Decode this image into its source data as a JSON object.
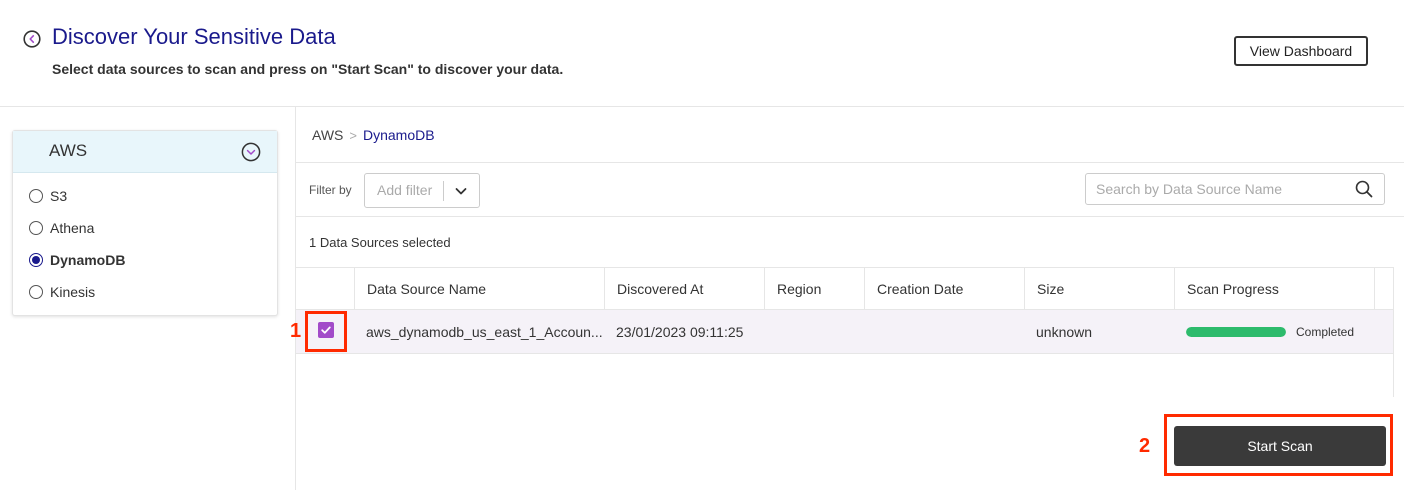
{
  "header": {
    "title": "Discover Your Sensitive Data",
    "subtitle": "Select data sources to scan and press on \"Start Scan\" to discover your data.",
    "view_dashboard_label": "View Dashboard",
    "back_icon": "chevron-left-circle-icon",
    "title_color": "#1a1a8c"
  },
  "sidebar": {
    "provider": "AWS",
    "toggle_icon": "chevron-down-circle-icon",
    "options": [
      {
        "label": "S3",
        "selected": false
      },
      {
        "label": "Athena",
        "selected": false
      },
      {
        "label": "DynamoDB",
        "selected": true
      },
      {
        "label": "Kinesis",
        "selected": false
      }
    ]
  },
  "breadcrumb": {
    "root": "AWS",
    "separator": ">",
    "current": "DynamoDB"
  },
  "filter": {
    "label": "Filter by",
    "placeholder": "Add filter"
  },
  "search": {
    "placeholder": "Search by Data Source Name"
  },
  "selection": {
    "count_text": "1 Data Sources selected"
  },
  "table": {
    "columns": [
      "Data Source Name",
      "Discovered At",
      "Region",
      "Creation Date",
      "Size",
      "Scan Progress"
    ],
    "rows": [
      {
        "checked": true,
        "name": "aws_dynamodb_us_east_1_Accoun...",
        "discovered_at": "23/01/2023 09:11:25",
        "region": "",
        "creation_date": "",
        "size": "unknown",
        "progress": 1.0,
        "progress_label": "Completed"
      }
    ]
  },
  "actions": {
    "start_scan_label": "Start Scan"
  },
  "annotations": [
    {
      "label": "1"
    },
    {
      "label": "2"
    }
  ],
  "colors": {
    "accent": "#1a1a8c",
    "checkbox": "#a24bc9",
    "progress": "#2dbb6c",
    "annotation": "#ff2a00",
    "button_dark": "#3a3a3a"
  }
}
